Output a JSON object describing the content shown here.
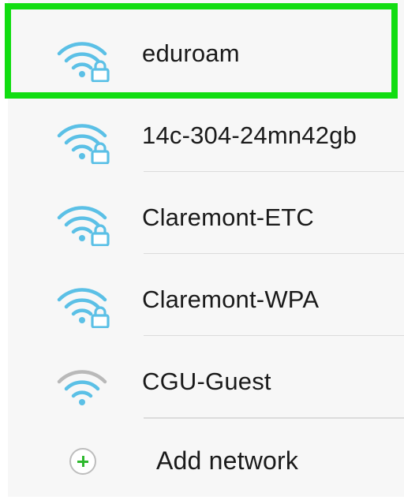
{
  "networks": [
    {
      "ssid": "eduroam",
      "secured": true,
      "icon": "wifi-lock-icon",
      "highlighted": true
    },
    {
      "ssid": "14c-304-24mn42gb",
      "secured": true,
      "icon": "wifi-lock-icon"
    },
    {
      "ssid": "Claremont-ETC",
      "secured": true,
      "icon": "wifi-lock-icon"
    },
    {
      "ssid": "Claremont-WPA",
      "secured": true,
      "icon": "wifi-lock-icon"
    },
    {
      "ssid": "CGU-Guest",
      "secured": false,
      "icon": "wifi-icon"
    }
  ],
  "add_network": {
    "label": "Add network",
    "icon": "plus-circle-icon"
  },
  "colors": {
    "wifi_blue": "#5bc0e6",
    "wifi_grey": "#b9b9b9",
    "highlight": "#11dd11",
    "plus_green": "#2eb82e"
  }
}
